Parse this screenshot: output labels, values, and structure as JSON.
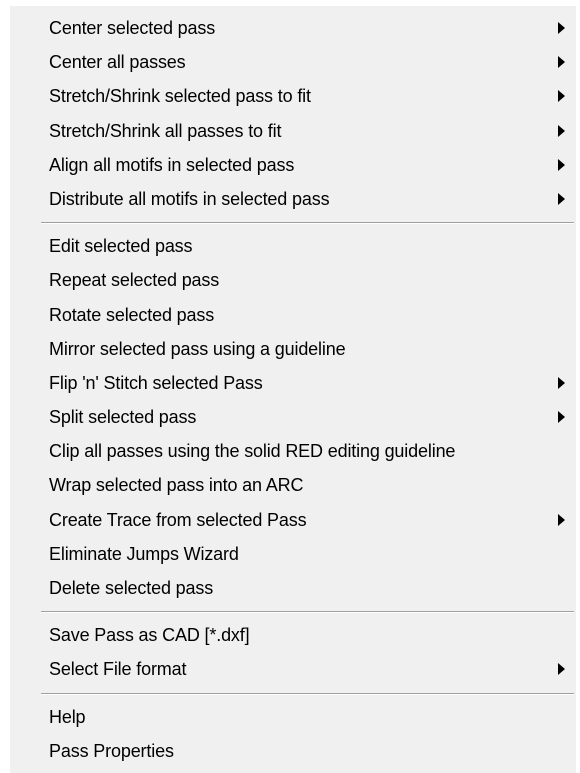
{
  "menu": {
    "groups": [
      {
        "items": [
          {
            "label": "Center selected pass",
            "has_submenu": true
          },
          {
            "label": "Center all passes",
            "has_submenu": true
          },
          {
            "label": "Stretch/Shrink selected pass to fit",
            "has_submenu": true
          },
          {
            "label": "Stretch/Shrink all passes to fit",
            "has_submenu": true
          },
          {
            "label": "Align all motifs in selected pass",
            "has_submenu": true
          },
          {
            "label": "Distribute all motifs in selected pass",
            "has_submenu": true
          }
        ]
      },
      {
        "items": [
          {
            "label": "Edit selected pass",
            "has_submenu": false
          },
          {
            "label": "Repeat selected pass",
            "has_submenu": false
          },
          {
            "label": "Rotate selected pass",
            "has_submenu": false
          },
          {
            "label": "Mirror selected pass using a guideline",
            "has_submenu": false
          },
          {
            "label": "Flip 'n' Stitch selected Pass",
            "has_submenu": true
          },
          {
            "label": "Split selected pass",
            "has_submenu": true
          },
          {
            "label": "Clip all passes using the solid RED editing guideline",
            "has_submenu": false
          },
          {
            "label": "Wrap selected pass into an ARC",
            "has_submenu": false
          },
          {
            "label": "Create Trace from selected Pass",
            "has_submenu": true
          },
          {
            "label": "Eliminate Jumps Wizard",
            "has_submenu": false
          },
          {
            "label": "Delete selected pass",
            "has_submenu": false
          }
        ]
      },
      {
        "items": [
          {
            "label": "Save Pass as CAD [*.dxf]",
            "has_submenu": false
          },
          {
            "label": "Select File format",
            "has_submenu": true
          }
        ]
      },
      {
        "items": [
          {
            "label": "Help",
            "has_submenu": false
          },
          {
            "label": "Pass Properties",
            "has_submenu": false
          }
        ]
      }
    ]
  }
}
